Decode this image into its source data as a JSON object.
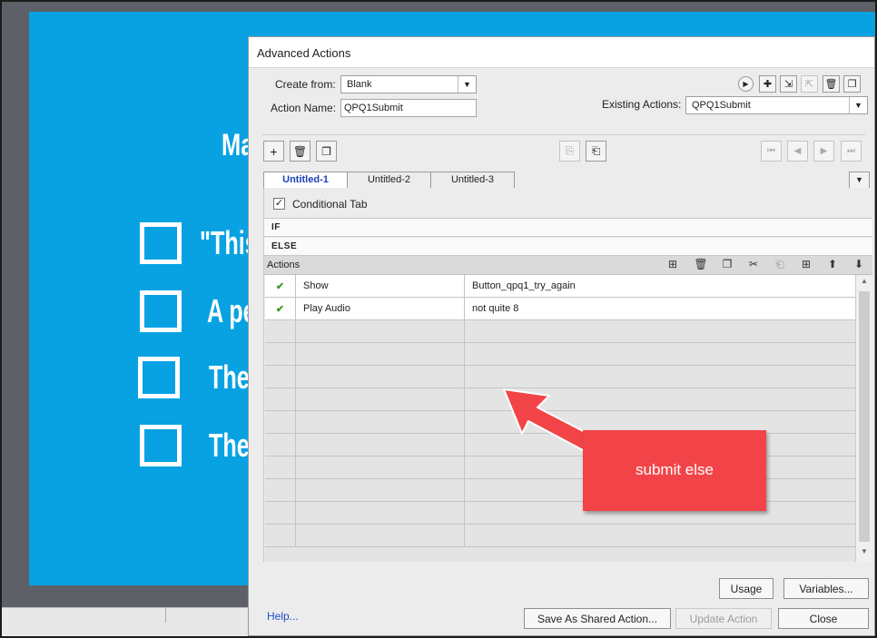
{
  "slide": {
    "title_fragment": "Ma",
    "options": [
      {
        "text": "\"This"
      },
      {
        "text": "A pe"
      },
      {
        "text": "The"
      },
      {
        "text": "The"
      }
    ]
  },
  "dialog": {
    "title": "Advanced Actions",
    "create_from_label": "Create from:",
    "create_from_value": "Blank",
    "action_name_label": "Action Name:",
    "action_name_value": "QPQ1Submit",
    "existing_actions_label": "Existing Actions:",
    "existing_actions_value": "QPQ1Submit",
    "tabs": [
      {
        "label": "Untitled-1",
        "active": true
      },
      {
        "label": "Untitled-2",
        "active": false
      },
      {
        "label": "Untitled-3",
        "active": false
      }
    ],
    "conditional_tab_label": "Conditional Tab",
    "conditional_tab_checked": true,
    "if_label": "IF",
    "else_label": "ELSE",
    "actions_label": "Actions",
    "actions": [
      {
        "status": "✔",
        "action": "Show",
        "target": "Button_qpq1_try_again"
      },
      {
        "status": "✔",
        "action": "Play Audio",
        "target": "not quite 8"
      }
    ],
    "empty_rows": 10,
    "usage_button": "Usage",
    "variables_button": "Variables...",
    "help_link": "Help...",
    "save_shared_button": "Save As Shared Action...",
    "update_action_button": "Update Action",
    "close_button": "Close"
  },
  "annotation": {
    "text": "submit else",
    "color": "#f24448"
  },
  "colors": {
    "slide_bg": "#08a2e3",
    "check_green": "#3a9a22",
    "active_tab_text": "#1a3fb8"
  }
}
